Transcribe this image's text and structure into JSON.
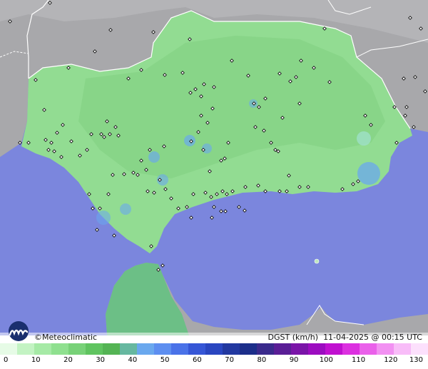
{
  "map": {
    "credit": "©Meteoclimatic",
    "variable": "DGST (km/h)",
    "timestamp": "11-04-2025 @ 00:15 UTC",
    "colors": {
      "sea": "#7b86dd",
      "outside_land": "#a9a9a9",
      "region": "#92dc92",
      "border": "#ffffff"
    }
  },
  "legend": {
    "labels": [
      "0",
      "10",
      "20",
      "30",
      "40",
      "50",
      "60",
      "70",
      "80",
      "90",
      "100",
      "110",
      "120",
      "130"
    ],
    "colors": [
      "#e6fbe6",
      "#c3f3c3",
      "#a6eaa6",
      "#8fe08f",
      "#78d278",
      "#60c460",
      "#54b454",
      "#66b8a0",
      "#6aa8ee",
      "#5d8ef0",
      "#4a72e8",
      "#3656d6",
      "#2a46c0",
      "#2238a0",
      "#1c2e8a",
      "#3a2a8c",
      "#5a1e96",
      "#7a14a8",
      "#9c0cc0",
      "#c010d0",
      "#dc30e0",
      "#ea60ea",
      "#f290f2",
      "#f8bcf8",
      "#fce0fc"
    ]
  }
}
